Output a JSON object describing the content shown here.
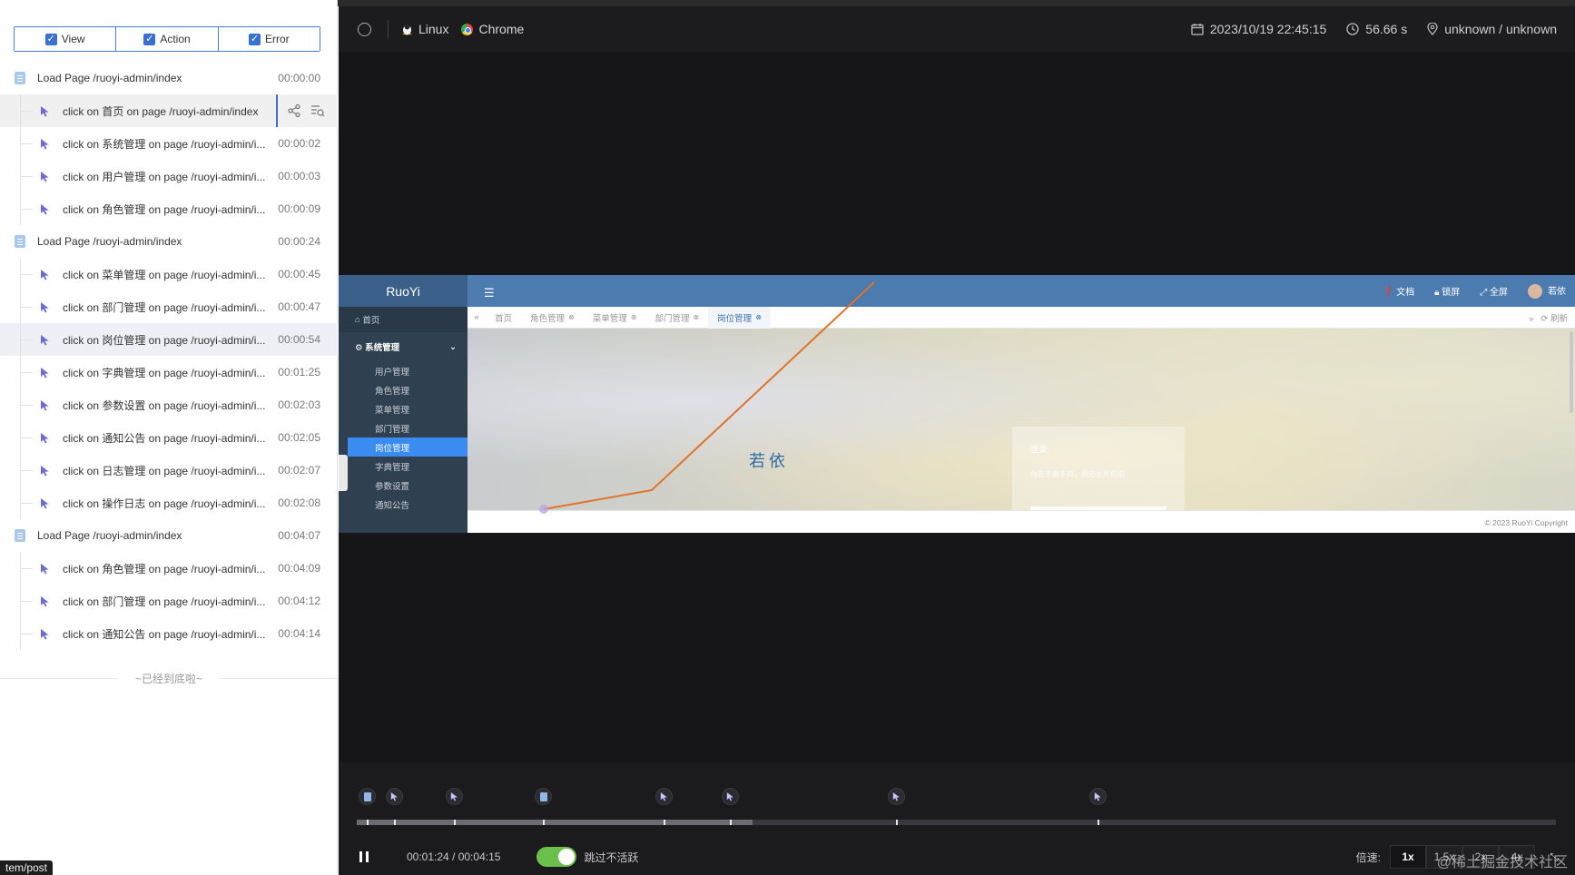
{
  "filters": [
    {
      "label": "View",
      "checked": true
    },
    {
      "label": "Action",
      "checked": true
    },
    {
      "label": "Error",
      "checked": true
    }
  ],
  "events": [
    {
      "type": "page",
      "text": "Load Page /ruoyi-admin/index",
      "time": "00:00:00"
    },
    {
      "type": "click",
      "text": "click on 首页 on page /ruoyi-admin/index",
      "time": "",
      "selected": true
    },
    {
      "type": "click",
      "text": "click on 系统管理 on page /ruoyi-admin/i...",
      "time": "00:00:02"
    },
    {
      "type": "click",
      "text": "click on 用户管理 on page /ruoyi-admin/i...",
      "time": "00:00:03"
    },
    {
      "type": "click",
      "text": "click on 角色管理 on page /ruoyi-admin/i...",
      "time": "00:00:09"
    },
    {
      "type": "page",
      "text": "Load Page /ruoyi-admin/index",
      "time": "00:00:24"
    },
    {
      "type": "click",
      "text": "click on 菜单管理 on page /ruoyi-admin/i...",
      "time": "00:00:45"
    },
    {
      "type": "click",
      "text": "click on 部门管理 on page /ruoyi-admin/i...",
      "time": "00:00:47"
    },
    {
      "type": "click",
      "text": "click on 岗位管理 on page /ruoyi-admin/i...",
      "time": "00:00:54",
      "highlight": true
    },
    {
      "type": "click",
      "text": "click on 字典管理 on page /ruoyi-admin/i...",
      "time": "00:01:25"
    },
    {
      "type": "click",
      "text": "click on 参数设置 on page /ruoyi-admin/i...",
      "time": "00:02:03"
    },
    {
      "type": "click",
      "text": "click on 通知公告 on page /ruoyi-admin/i...",
      "time": "00:02:05"
    },
    {
      "type": "click",
      "text": "click on 日志管理 on page /ruoyi-admin/i...",
      "time": "00:02:07"
    },
    {
      "type": "click",
      "text": "click on 操作日志 on page /ruoyi-admin/i...",
      "time": "00:02:08"
    },
    {
      "type": "page",
      "text": "Load Page /ruoyi-admin/index",
      "time": "00:04:07"
    },
    {
      "type": "click",
      "text": "click on 角色管理 on page /ruoyi-admin/i...",
      "time": "00:04:09"
    },
    {
      "type": "click",
      "text": "click on 部门管理 on page /ruoyi-admin/i...",
      "time": "00:04:12"
    },
    {
      "type": "click",
      "text": "click on 通知公告 on page /ruoyi-admin/i...",
      "time": "00:04:14"
    }
  ],
  "end_note": "~已经到底啦~",
  "url_tooltip": "tem/post",
  "player": {
    "os": "Linux",
    "browser": "Chrome",
    "datetime": "2023/10/19 22:45:15",
    "duration": "56.66 s",
    "location": "unknown / unknown",
    "current_time": "00:01:24 / 00:04:15",
    "progress_fraction": 0.33,
    "skip_inactive_label": "跳过不活跃",
    "skip_inactive_on": true,
    "speed_label": "倍速:",
    "speeds": [
      "1x",
      "1.5x",
      "2x",
      "4x"
    ],
    "active_speed": "1x",
    "watermark": "@稀土掘金技术社区",
    "timeline_markers": [
      {
        "type": "page",
        "fraction": 0.008
      },
      {
        "type": "click",
        "fraction": 0.031
      },
      {
        "type": "click",
        "fraction": 0.081
      },
      {
        "type": "page",
        "fraction": 0.155
      },
      {
        "type": "click",
        "fraction": 0.256
      },
      {
        "type": "click",
        "fraction": 0.311
      },
      {
        "type": "click",
        "fraction": 0.45
      },
      {
        "type": "click",
        "fraction": 0.618
      }
    ]
  },
  "recorded_page": {
    "logo": "RuoYi",
    "header_links": [
      "文档",
      "锁屏",
      "全屏",
      "若依"
    ],
    "tabs": [
      "首页",
      "角色管理",
      "菜单管理",
      "部门管理",
      "岗位管理"
    ],
    "active_tab": "岗位管理",
    "refresh_label": "刷新",
    "sidebar_home": "首页",
    "sidebar_group": "系统管理",
    "sidebar_items": [
      "用户管理",
      "角色管理",
      "菜单管理",
      "部门管理",
      "岗位管理",
      "字典管理",
      "参数设置",
      "通知公告"
    ],
    "active_item": "岗位管理",
    "brand_text": "若依",
    "login_title": "登录:",
    "login_sub": "你若不离不弃，我必生死相依",
    "copyright": "© 2023 RuoYi Copyright"
  },
  "colors": {
    "accent": "#3a70d2",
    "mouse_trail": "#e0732a",
    "toggle_on": "#6bc04b"
  }
}
